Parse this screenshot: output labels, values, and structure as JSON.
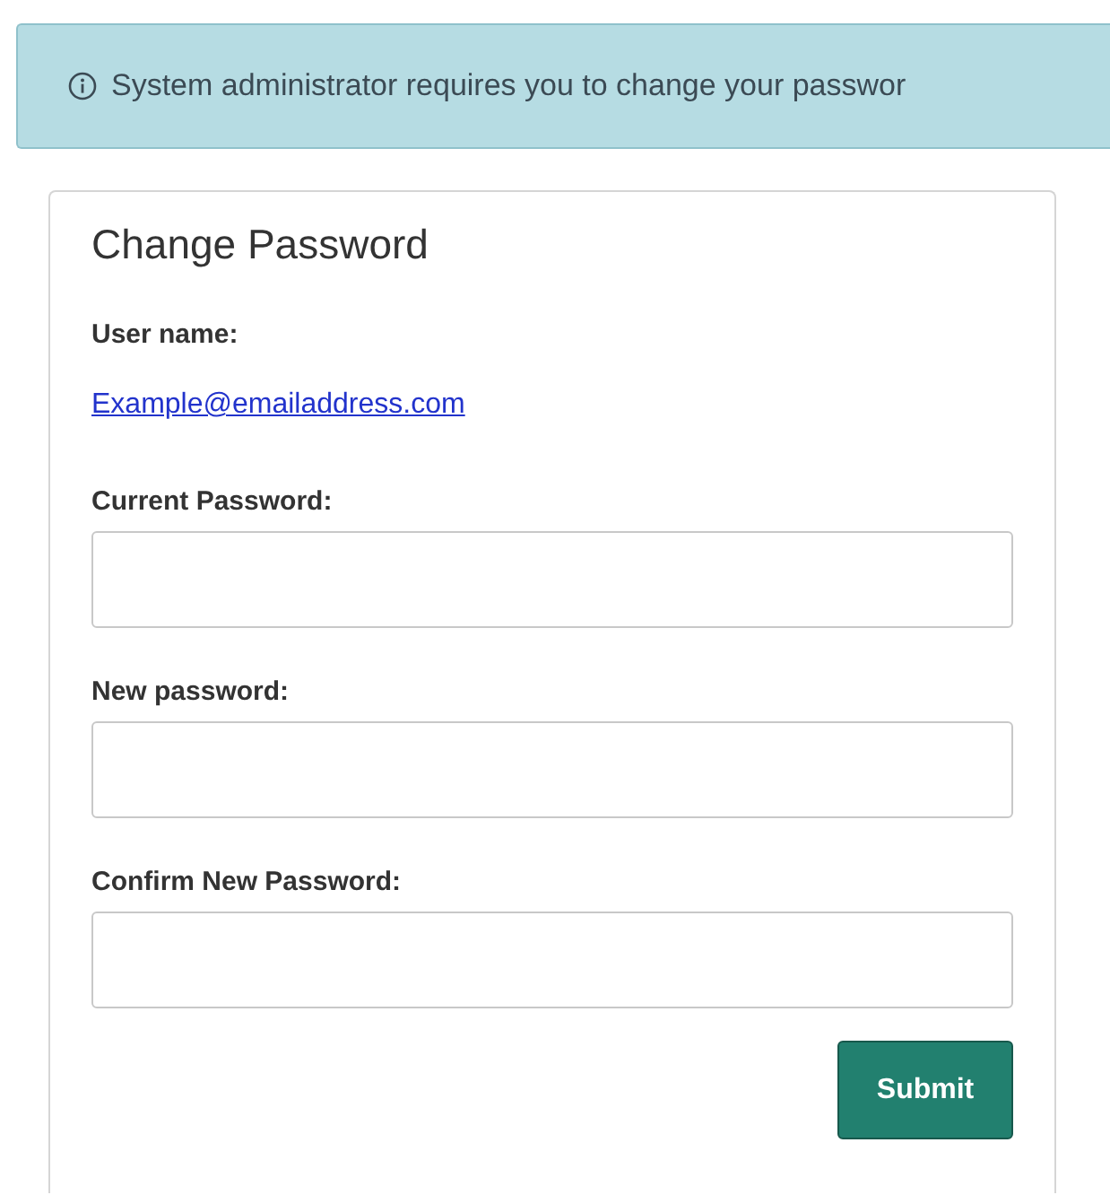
{
  "alert": {
    "text": "System administrator requires you to change your passwor"
  },
  "form": {
    "title": "Change Password",
    "username_label": "User name:",
    "username": "Example@emailaddress.com",
    "fields": [
      {
        "label": "Current Password:"
      },
      {
        "label": "New password:"
      },
      {
        "label": "Confirm New Password:"
      }
    ],
    "submit": "Submit"
  }
}
